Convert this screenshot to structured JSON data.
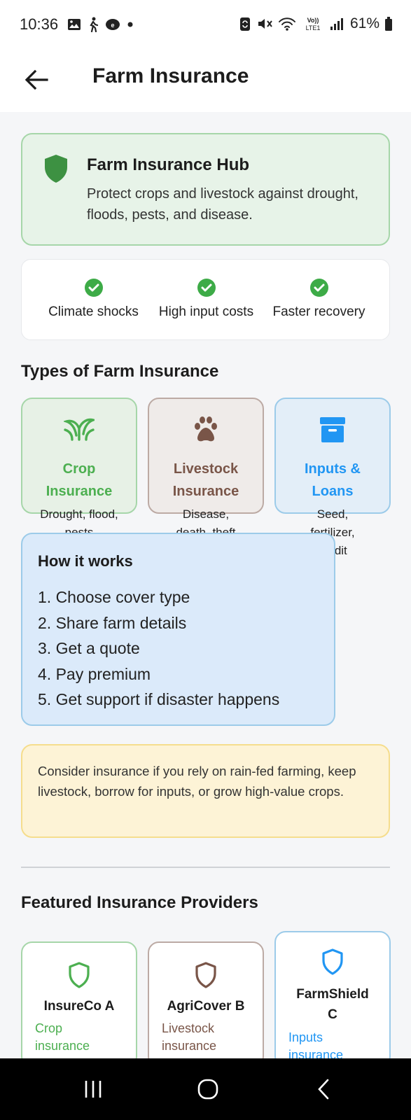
{
  "status_bar": {
    "time": "10:36",
    "battery": "61%",
    "left_icons": [
      "image-icon",
      "walking-person-icon",
      "messaging-app-icon",
      "dot-icon"
    ],
    "right_icons": [
      "sync-icon",
      "mute-icon",
      "wifi-icon",
      "volte-icon",
      "signal-icon",
      "battery-icon"
    ],
    "volte_text": "Vo)) LTE1"
  },
  "app_bar": {
    "title": "Farm Insurance",
    "back_icon": "arrow-left-icon"
  },
  "hub": {
    "title": "Farm Insurance Hub",
    "description": "Protect crops and livestock against drought, floods, pests, and disease.",
    "icon": "shield-icon"
  },
  "benefits": [
    {
      "label": "Climate shocks",
      "icon": "check-circle-icon"
    },
    {
      "label": "High input costs",
      "icon": "check-circle-icon"
    },
    {
      "label": "Faster recovery",
      "icon": "check-circle-icon"
    }
  ],
  "types_section": {
    "title": "Types of Farm Insurance",
    "items": [
      {
        "label_line1": "Crop",
        "label_line2": "Insurance",
        "desc_line1": "Drought, flood,",
        "desc_line2": "pests",
        "icon": "sprout-icon",
        "color": "#4caf50"
      },
      {
        "label_line1": "Livestock",
        "label_line2": "Insurance",
        "desc_line1": "Disease,",
        "desc_line2": "death, theft",
        "icon": "paw-icon",
        "color": "#795548"
      },
      {
        "label_line1": "Inputs &",
        "label_line2": "Loans",
        "desc_line1": "Seed,",
        "desc_line2": "fertilizer,",
        "desc_line3": "credit",
        "icon": "archive-box-icon",
        "color": "#2196f3"
      }
    ]
  },
  "how_it_works": {
    "title": "How it works",
    "steps": [
      "1. Choose cover type",
      "2. Share farm details",
      "3. Get a quote",
      "4. Pay premium",
      "5. Get support if disaster happens"
    ]
  },
  "tip": {
    "text": "Consider insurance if you rely on rain-fed farming, keep livestock, borrow for inputs, or grow high-value crops."
  },
  "providers_section": {
    "title": "Featured Insurance Providers",
    "items": [
      {
        "name": "InsureCo A",
        "type_line1": "Crop",
        "type_line2": "insurance",
        "icon": "shield-outline-icon",
        "color": "#4caf50"
      },
      {
        "name": "AgriCover B",
        "type_line1": "Livestock",
        "type_line2": "insurance",
        "icon": "shield-outline-icon",
        "color": "#795548"
      },
      {
        "name_line1": "FarmShield",
        "name_line2": "C",
        "type_line1": "Inputs",
        "type_line2": "insurance",
        "icon": "shield-outline-icon",
        "color": "#2196f3"
      }
    ]
  },
  "nav_bar": {
    "recents_icon": "recents-icon",
    "home_icon": "home-icon",
    "back_icon": "nav-back-icon"
  }
}
